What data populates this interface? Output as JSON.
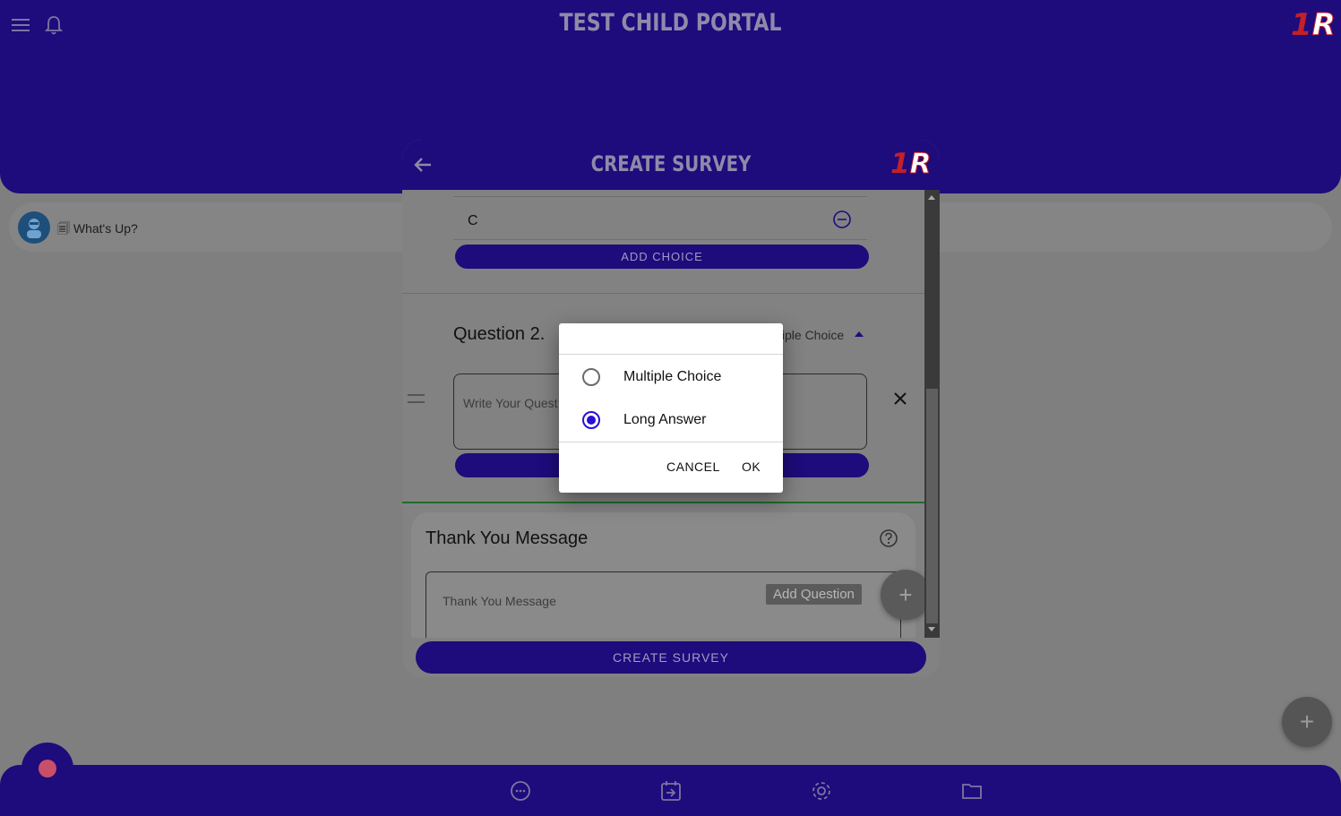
{
  "app": {
    "title": "TEST CHILD PORTAL",
    "logo_one": "1",
    "logo_r": "R"
  },
  "status": {
    "text": "🗐 What's Up?"
  },
  "modal": {
    "title": "CREATE SURVEY",
    "choice_value": "C",
    "add_choice_label": "ADD CHOICE",
    "question_label": "Question 2.",
    "question_type": "tiple Choice",
    "question_placeholder": "Write Your Quest",
    "thank_you_title": "Thank You Message",
    "thank_you_placeholder": "Thank You Message",
    "add_question_tooltip": "Add Question",
    "create_button": "CREATE SURVEY"
  },
  "dialog": {
    "options": [
      {
        "label": "Multiple Choice",
        "selected": false
      },
      {
        "label": "Long Answer",
        "selected": true
      }
    ],
    "cancel_label": "CANCEL",
    "ok_label": "OK"
  },
  "icons": {
    "menu": "menu-icon",
    "bell": "bell-icon",
    "back": "arrow-left-icon",
    "chat": "chat-icon",
    "calendar": "calendar-import-icon",
    "settings": "gear-icon",
    "folder": "folder-icon"
  },
  "colors": {
    "brand": "#1e0b7c",
    "accent": "#2a0fd6",
    "logo_red": "#c3202a",
    "record": "#c94f69"
  }
}
